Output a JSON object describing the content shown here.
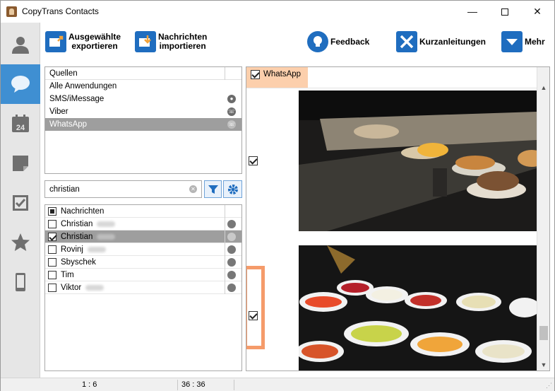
{
  "window": {
    "title": "CopyTrans Contacts"
  },
  "window_controls": {
    "minimize": "—",
    "close": "✕"
  },
  "sidebar": {
    "items": [
      {
        "icon": "person-icon",
        "active": false
      },
      {
        "icon": "chat-bubble-icon",
        "active": true
      },
      {
        "icon": "calendar-icon",
        "label": "24",
        "active": false
      },
      {
        "icon": "note-icon",
        "active": false
      },
      {
        "icon": "checklist-icon",
        "active": false
      },
      {
        "icon": "star-icon",
        "active": false
      },
      {
        "icon": "phone-icon",
        "active": false
      }
    ]
  },
  "toolbar": {
    "export_line1": "Ausgewählte",
    "export_line2": "exportieren",
    "import_line1": "Nachrichten",
    "import_line2": "importieren",
    "feedback": "Feedback",
    "guides": "Kurzanleitungen",
    "more": "Mehr"
  },
  "sources": {
    "header": "Quellen",
    "items": [
      {
        "label": "Alle Anwendungen",
        "icon": ""
      },
      {
        "label": "SMS/iMessage",
        "icon": "sms-icon"
      },
      {
        "label": "Viber",
        "icon": "viber-icon"
      },
      {
        "label": "WhatsApp",
        "icon": "whatsapp-icon",
        "selected": true
      }
    ]
  },
  "search": {
    "value": "christian",
    "clear": "✕"
  },
  "contacts": {
    "header": "Nachrichten",
    "rows": [
      {
        "name": "Christian",
        "checked": false,
        "selected": false
      },
      {
        "name": "Christian",
        "checked": true,
        "selected": true
      },
      {
        "name": "Rovinj",
        "checked": false,
        "selected": false
      },
      {
        "name": "Sbyschek",
        "checked": false,
        "selected": false
      },
      {
        "name": "Tim",
        "checked": false,
        "selected": false
      },
      {
        "name": "Viktor",
        "checked": false,
        "selected": false
      }
    ]
  },
  "chat": {
    "header_label": "WhatsApp",
    "messages": [
      {
        "type": "photo",
        "checked": true,
        "description": "dessert buffet"
      },
      {
        "type": "photo",
        "checked": true,
        "description": "salad buffet"
      }
    ]
  },
  "statusbar": {
    "left": "1 : 6",
    "right": "36 : 36"
  },
  "colors": {
    "accent": "#3f8fd2",
    "highlight": "#f59b6a",
    "selection": "#9e9e9e"
  }
}
